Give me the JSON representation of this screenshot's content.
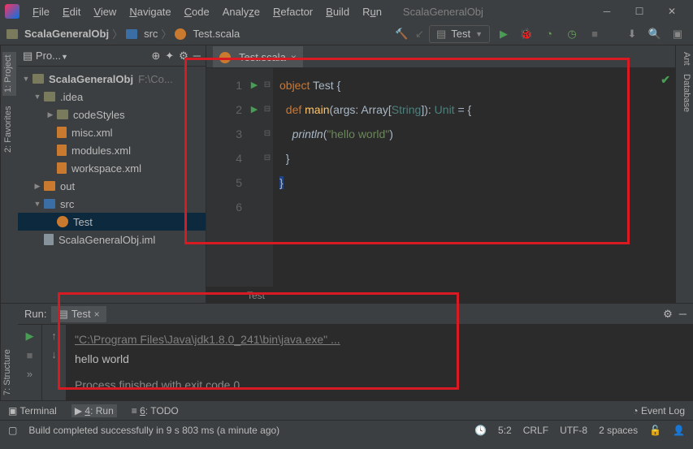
{
  "titlebar": {
    "window_title": "ScalaGeneralObj"
  },
  "menu": {
    "file": "File",
    "edit": "Edit",
    "view": "View",
    "navigate": "Navigate",
    "code": "Code",
    "analyze": "Analyze",
    "refactor": "Refactor",
    "build": "Build",
    "run": "Run"
  },
  "breadcrumb": {
    "project": "ScalaGeneralObj",
    "folder": "src",
    "file": "Test.scala"
  },
  "run_config": {
    "selected": "Test"
  },
  "project_panel": {
    "title": "Pro...",
    "root": {
      "name": "ScalaGeneralObj",
      "path": "F:\\Co..."
    },
    "idea": ".idea",
    "codeStyles": "codeStyles",
    "misc": "misc.xml",
    "modules": "modules.xml",
    "workspace": "workspace.xml",
    "out": "out",
    "src": "src",
    "test": "Test",
    "iml": "ScalaGeneralObj.iml"
  },
  "editor": {
    "tab": "Test.scala",
    "breadcrumb": "Test",
    "lines": [
      "1",
      "2",
      "3",
      "4",
      "5",
      "6"
    ],
    "code": {
      "kw_object": "object",
      "cls": "Test",
      "brace_o": "{",
      "kw_def": "def",
      "fn_main": "main",
      "args": "(args: ",
      "arr": "Array",
      "br1": "[",
      "str_t": "String",
      "br2": "]): ",
      "unit": "Unit",
      "eq": " = {",
      "println": "println",
      "paren": "(",
      "hello": "\"hello world\"",
      "cparen": ")",
      "cbrace": "}",
      "cbrace2": "}"
    }
  },
  "run_panel": {
    "title": "Run:",
    "tab": "Test",
    "cmd": "\"C:\\Program Files\\Java\\jdk1.8.0_241\\bin\\java.exe\" ...",
    "output": "hello world",
    "exit": "Process finished with exit code 0"
  },
  "bottom": {
    "terminal": "Terminal",
    "run": "4: Run",
    "todo": "6: TODO",
    "eventlog": "Event Log"
  },
  "status": {
    "msg": "Build completed successfully in 9 s 803 ms (a minute ago)",
    "pos": "5:2",
    "crlf": "CRLF",
    "enc": "UTF-8",
    "indent": "2 spaces"
  },
  "left_tabs": {
    "project": "1: Project",
    "favorites": "2: Favorites"
  },
  "left_tabs2": {
    "structure": "7: Structure"
  },
  "right_tabs": {
    "ant": "Ant",
    "database": "Database"
  }
}
